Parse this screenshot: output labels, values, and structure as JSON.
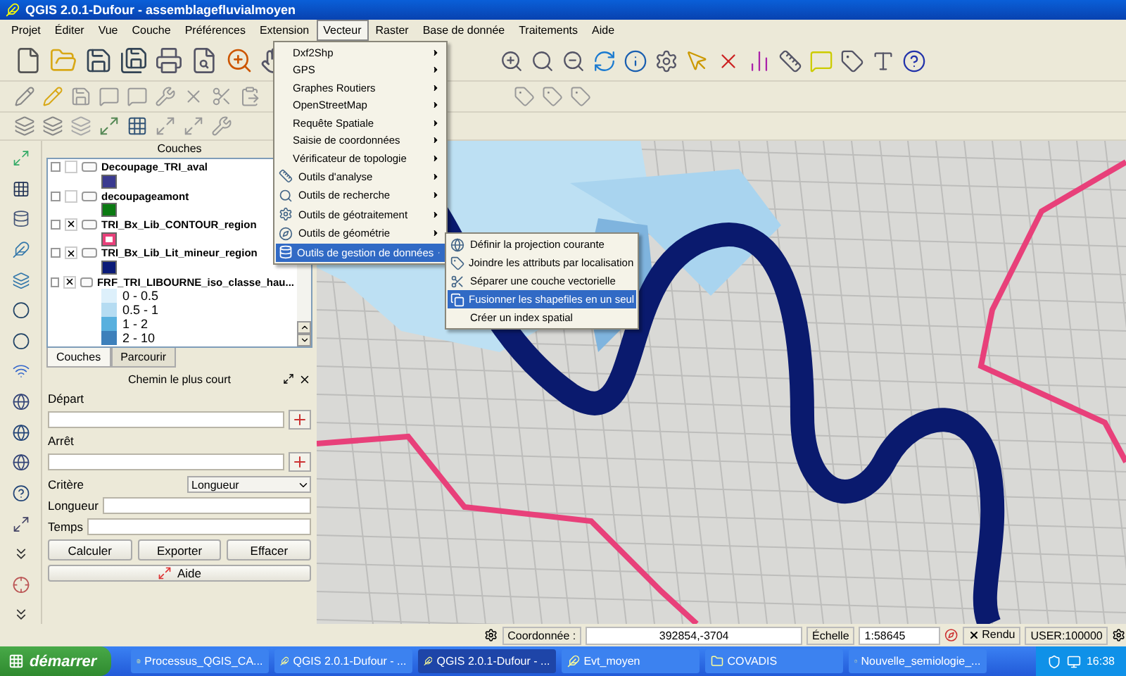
{
  "window": {
    "title": "QGIS 2.0.1-Dufour - assemblagefluvialmoyen"
  },
  "menu_bar": [
    {
      "label": "Projet",
      "selected": false
    },
    {
      "label": "Éditer",
      "selected": false
    },
    {
      "label": "Vue",
      "selected": false
    },
    {
      "label": "Couche",
      "selected": false
    },
    {
      "label": "Préférences",
      "selected": false
    },
    {
      "label": "Extension",
      "selected": false
    },
    {
      "label": "Vecteur",
      "selected": true
    },
    {
      "label": "Raster",
      "selected": false
    },
    {
      "label": "Base de donnée",
      "selected": false
    },
    {
      "label": "Traitements",
      "selected": false
    },
    {
      "label": "Aide",
      "selected": false
    }
  ],
  "vector_menu": [
    {
      "label": "Dxf2Shp",
      "selected": false
    },
    {
      "label": "GPS",
      "selected": false
    },
    {
      "label": "Graphes Routiers",
      "selected": false
    },
    {
      "label": "OpenStreetMap",
      "selected": false
    },
    {
      "label": "Requête Spatiale",
      "selected": false
    },
    {
      "label": "Saisie de coordonnées",
      "selected": false
    },
    {
      "label": "Vérificateur de topologie",
      "selected": false
    },
    {
      "label": "Outils d'analyse",
      "selected": false
    },
    {
      "label": "Outils de recherche",
      "selected": false
    },
    {
      "label": "Outils de géotraitement",
      "selected": false
    },
    {
      "label": "Outils de géométrie",
      "selected": false
    },
    {
      "label": "Outils de gestion de données",
      "selected": true
    }
  ],
  "submenu": [
    {
      "label": "Définir la projection courante",
      "selected": false
    },
    {
      "label": "Joindre les attributs par localisation",
      "selected": false
    },
    {
      "label": "Séparer une couche vectorielle",
      "selected": false
    },
    {
      "label": "Fusionner les shapefiles en un seul",
      "selected": true
    },
    {
      "label": "Créer un index spatial",
      "selected": false
    }
  ],
  "layers_panel": {
    "title": "Couches",
    "layers": [
      {
        "name": "Decoupage_TRI_aval",
        "visible": false,
        "kind": "fill",
        "color": "#3a3a90"
      },
      {
        "name": "decoupageamont",
        "visible": false,
        "kind": "fill",
        "color": "#0b7a12"
      },
      {
        "name": "TRI_Bx_Lib_CONTOUR_region",
        "visible": true,
        "kind": "outline",
        "color": "#e8407a"
      },
      {
        "name": "TRI_Bx_Lib_Lit_mineur_region",
        "visible": true,
        "kind": "fill",
        "color": "#0a1a78"
      },
      {
        "name": "FRF_TRI_LIBOURNE_iso_classe_hau...",
        "visible": true,
        "kind": "classes",
        "children": [
          {
            "label": "0 - 0.5",
            "color": "#ddf0fb"
          },
          {
            "label": "0.5 - 1",
            "color": "#b5dcf2"
          },
          {
            "label": "1 - 2",
            "color": "#58b0de"
          },
          {
            "label": "2 - 10",
            "color": "#3d80bb"
          }
        ]
      }
    ]
  },
  "panel_tabs": [
    {
      "label": "Couches",
      "selected": true
    },
    {
      "label": "Parcourir",
      "selected": false
    }
  ],
  "shortest_path": {
    "title": "Chemin le plus court",
    "start_label": "Départ",
    "stop_label": "Arrêt",
    "criterion_label": "Critère",
    "criterion_value": "Longueur",
    "length_label": "Longueur",
    "time_label": "Temps",
    "buttons": [
      "Calculer",
      "Exporter",
      "Effacer"
    ],
    "help": "Aide"
  },
  "status_bar": {
    "coordinate_label": "Coordonnée :",
    "coordinate": "392854,-3704",
    "scale_label": "Échelle",
    "scale": "1:58645",
    "render": {
      "label": "Rendu",
      "checked": true
    },
    "crs": "USER:100000"
  },
  "taskbar": {
    "start": "démarrer",
    "tasks": [
      {
        "label": "Processus_QGIS_CA...",
        "kind": "document",
        "selected": false
      },
      {
        "label": "QGIS 2.0.1-Dufour - ...",
        "kind": "qgis",
        "selected": false
      },
      {
        "label": "QGIS 2.0.1-Dufour - ...",
        "kind": "qgis",
        "selected": true
      },
      {
        "label": "Evt_moyen",
        "kind": "qgis",
        "selected": false
      },
      {
        "label": "COVADIS",
        "kind": "folder",
        "selected": false
      },
      {
        "label": "Nouvelle_semiologie_...",
        "kind": "pdf",
        "selected": false
      }
    ],
    "clock": "16:38"
  }
}
